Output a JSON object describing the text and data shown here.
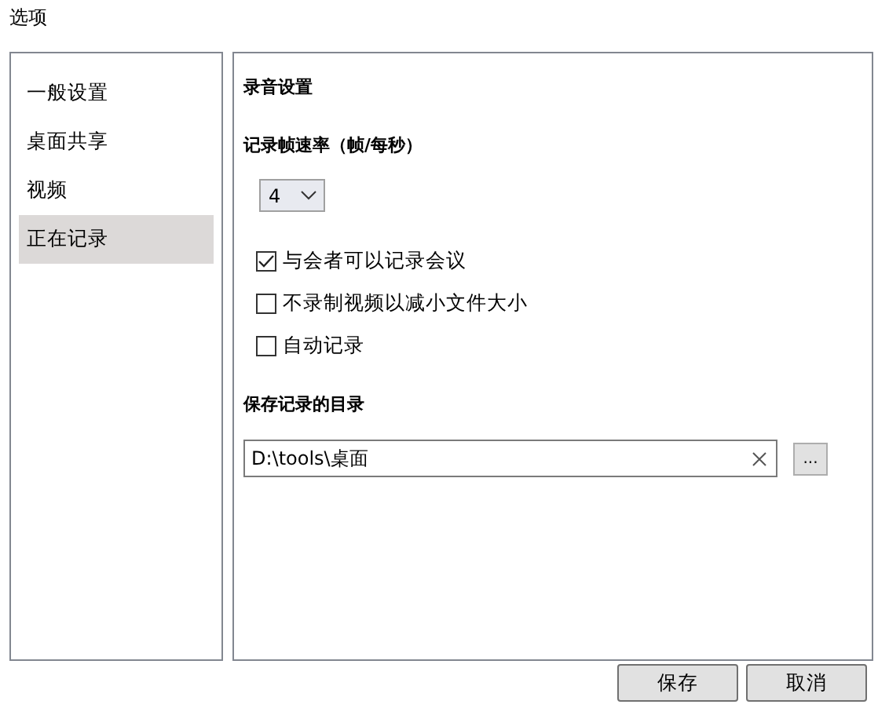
{
  "window": {
    "title": "选项"
  },
  "sidebar": {
    "items": [
      {
        "label": "一般设置",
        "selected": false
      },
      {
        "label": "桌面共享",
        "selected": false
      },
      {
        "label": "视频",
        "selected": false
      },
      {
        "label": "正在记录",
        "selected": true
      }
    ]
  },
  "section_title": "录音设置",
  "frame_rate": {
    "label": "记录帧速率（帧/每秒）",
    "value": "4"
  },
  "options": [
    {
      "label": "与会者可以记录会议",
      "checked": true
    },
    {
      "label": "不录制视频以减小文件大小",
      "checked": false
    },
    {
      "label": "自动记录",
      "checked": false
    }
  ],
  "directory": {
    "label": "保存记录的目录",
    "value": "D:\\tools\\桌面",
    "browse": "..."
  },
  "buttons": [
    "保存",
    "取消"
  ]
}
